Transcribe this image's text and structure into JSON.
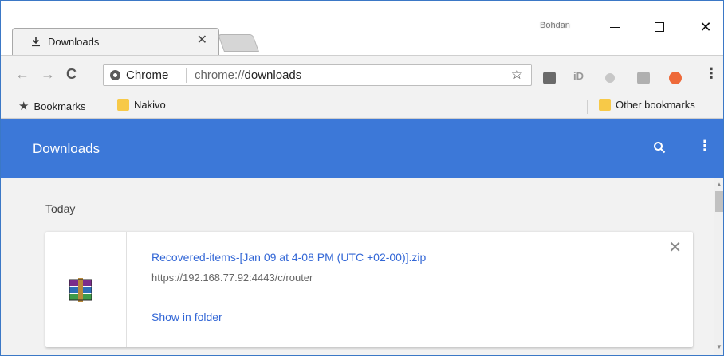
{
  "window": {
    "profile_name": "Bohdan",
    "minimize_label": "—",
    "maximize_label": "☐",
    "close_label": "✕"
  },
  "tab": {
    "title": "Downloads",
    "icon": "download-icon",
    "close_label": "✕"
  },
  "toolbar": {
    "back_icon": "←",
    "forward_icon": "→",
    "reload_icon": "C",
    "omnibox": {
      "chip": "Chrome",
      "url_scheme": "chrome://",
      "url_path": "downloads",
      "bookmark_icon": "☆"
    },
    "extensions": [
      "extension-1-icon",
      "extension-2-icon",
      "extension-3-icon",
      "extension-4-icon",
      "extension-5-icon"
    ],
    "ext2_label": "iD",
    "menu_icon": "⋮"
  },
  "bookmarks": {
    "bar_label": "Bookmarks",
    "star_icon": "★",
    "items": [
      {
        "label": "Nakivo",
        "icon": "folder-icon"
      }
    ],
    "other_label": "Other bookmarks"
  },
  "downloads_page": {
    "title": "Downloads",
    "more_icon": "⋮",
    "section_date": "Today",
    "item": {
      "file_name": "Recovered-items-[Jan 09 at 4-08 PM (UTC +02-00)].zip",
      "source_url": "https://192.168.77.92:4443/c/router",
      "action_label": "Show in folder",
      "close_label": "✕",
      "icon": "winrar-archive-icon"
    }
  },
  "colors": {
    "header_blue": "#3c78d8",
    "link_blue": "#3367d6",
    "window_border": "#3b78c6"
  }
}
